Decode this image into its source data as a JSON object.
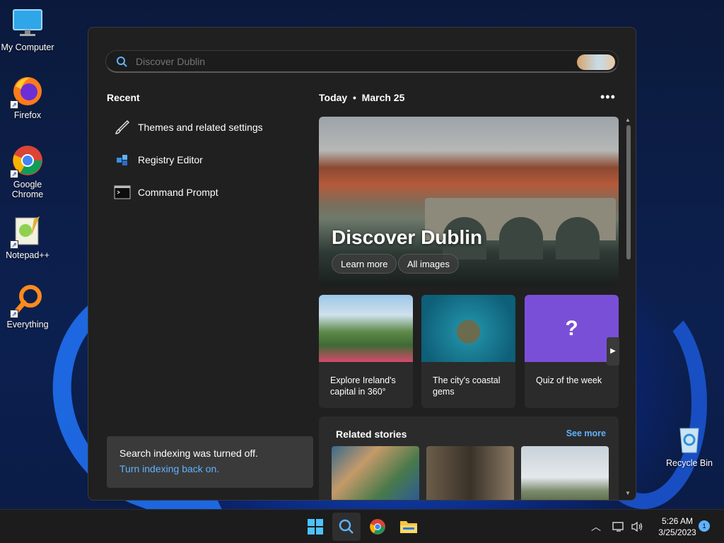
{
  "desktop": {
    "icons": [
      {
        "label": "My Computer",
        "icon": "monitor-icon"
      },
      {
        "label": "Firefox",
        "icon": "firefox-icon"
      },
      {
        "label": "Google Chrome",
        "icon": "chrome-icon"
      },
      {
        "label": "Notepad++",
        "icon": "notepadpp-icon"
      },
      {
        "label": "Everything",
        "icon": "everything-icon"
      },
      {
        "label": "Recycle Bin",
        "icon": "recycle-bin-icon"
      }
    ]
  },
  "search": {
    "placeholder": "Discover Dublin",
    "value": ""
  },
  "recent": {
    "title": "Recent",
    "items": [
      {
        "label": "Themes and related settings",
        "icon": "brush-icon"
      },
      {
        "label": "Registry Editor",
        "icon": "registry-icon"
      },
      {
        "label": "Command Prompt",
        "icon": "cmd-icon"
      }
    ]
  },
  "notice": {
    "text": "Search indexing was turned off.",
    "link": "Turn indexing back on."
  },
  "highlights": {
    "today": "Today",
    "date": "March 25",
    "more_glyph": "•••",
    "hero": {
      "title": "Discover Dublin",
      "learn_more": "Learn more",
      "all_images": "All images"
    },
    "cards": [
      {
        "caption": "Explore Ireland's capital in 360°"
      },
      {
        "caption": "The city's coastal gems"
      },
      {
        "caption": "Quiz of the week"
      }
    ]
  },
  "related": {
    "title": "Related stories",
    "see_more": "See more"
  },
  "taskbar": {
    "time": "5:26 AM",
    "date": "3/25/2023",
    "notification_count": "1",
    "colors": {
      "accent": "#5fb2ff",
      "bg": "#1c1c1c"
    }
  }
}
